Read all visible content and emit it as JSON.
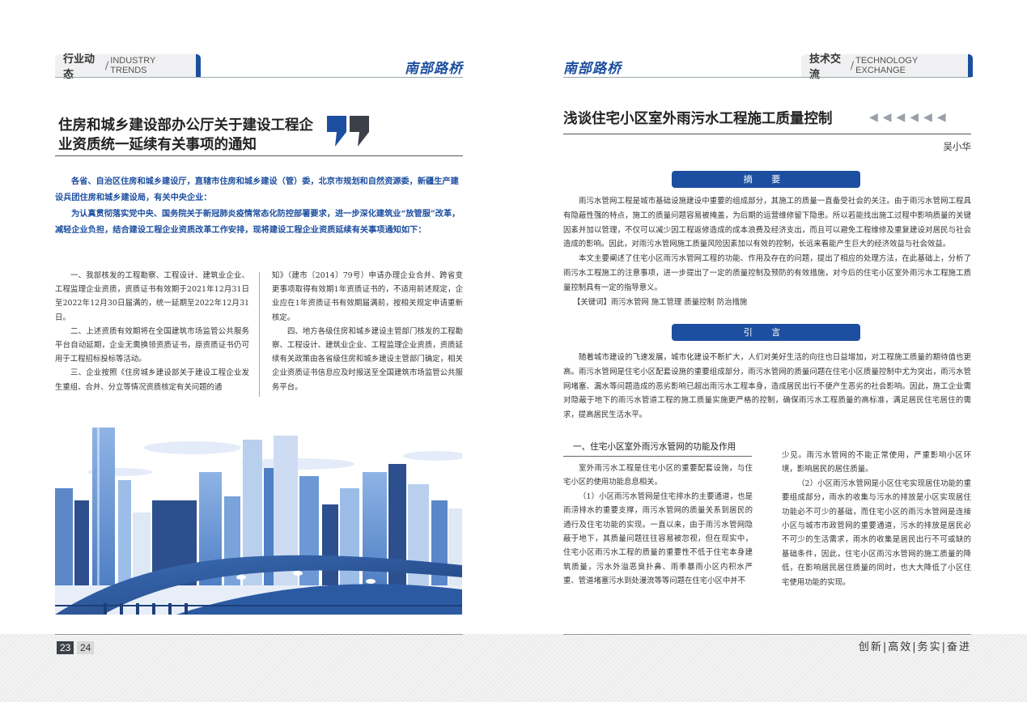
{
  "left": {
    "section_tab": {
      "zh": "行业动态",
      "sep": "/",
      "en": "INDUSTRY TRENDS"
    },
    "brand": "南部路桥",
    "title": "住房和城乡建设部办公厅关于建设工程企业资质统一延续有关事项的通知",
    "intro": [
      "各省、自治区住房和城乡建设厅，直辖市住房和城乡建设（管）委，北京市规划和自然资源委，新疆生产建设兵团住房和城乡建设局，有关中央企业：",
      "为认真贯彻落实党中央、国务院关于新冠肺炎疫情常态化防控部署要求，进一步深化建筑业“放管服”改革，减轻企业负担，结合建设工程企业资质改革工作安排，现将建设工程企业资质延续有关事项通知如下："
    ],
    "col1": [
      "一、我部核发的工程勘察、工程设计、建筑业企业、工程监理企业资质，资质证书有效期于2021年12月31日至2022年12月30日届满的，统一延期至2022年12月31日。",
      "二、上述资质有效期将在全国建筑市场监管公共服务平台自动延期，企业无需换领资质证书，原资质证书仍可用于工程招标投标等活动。",
      "三、企业按照《住房城乡建设部关于建设工程企业发生重组、合并、分立等情况资质核定有关问题的通"
    ],
    "col2": [
      "知》（建市〔2014〕79号）申请办理企业合并、跨省变更事项取得有效期1年资质证书的，不适用前述规定，企业应在1年资质证书有效期届满前，按相关规定申请重新核定。",
      "四、地方各级住房和城乡建设主管部门核发的工程勘察、工程设计、建筑业企业、工程监理企业资质，资质延续有关政策由各省级住房和城乡建设主管部门确定，相关企业资质证书信息应及时报送至全国建筑市场监管公共服务平台。"
    ],
    "page_numbers": [
      "23",
      "24"
    ]
  },
  "right": {
    "brand": "南部路桥",
    "section_tab": {
      "zh": "技术交流",
      "sep": "/",
      "en": "TECHNOLOGY EXCHANGE"
    },
    "title": "浅谈住宅小区室外雨污水工程施工质量控制",
    "arrows": "◀◀◀◀◀◀",
    "author": "吴小华",
    "abstract_label": "摘  要",
    "abstract": [
      "雨污水管网工程是城市基础设施建设中重要的组成部分，其施工的质量一直备受社会的关注。由于雨污水管网工程具有隐蔽性强的特点，施工的质量问题容易被掩盖，为后期的运营维修留下隐患。所以若能找出施工过程中影响质量的关键因素并加以管理，不仅可以减少因工程返修造成的成本浪费及经济支出，而且可以避免工程维修及重复建设对居民与社会造成的影响。因此，对雨污水管网施工质量风险因素加以有效的控制，长远来看能产生巨大的经济效益与社会效益。",
      "本文主要阐述了住宅小区雨污水管网工程的功能、作用及存在的问题，提出了相应的处理方法，在此基础上，分析了雨污水工程施工的注意事项，进一步提出了一定的质量控制及预防的有效措施，对今后的住宅小区室外雨污水工程施工质量控制具有一定的指导意义。"
    ],
    "keywords": "【关键词】雨污水管网  施工管理  质量控制  防治措施",
    "intro_label": "引  言",
    "intro": "随着城市建设的飞速发展，城市化建设不断扩大，人们对美好生活的向往也日益增加，对工程施工质量的期待值也更高。雨污水管网是住宅小区配套设施的重要组成部分，雨污水管网的质量问题在住宅小区质量控制中尤为突出，雨污水管网堵塞、漏水等问题造成的恶劣影响已超出雨污水工程本身，造成居民出行不便产生恶劣的社会影响。因此，施工企业需对隐蔽于地下的雨污水管道工程的施工质量实施更严格的控制，确保雨污水工程质量的高标准，满足居民住宅居住的需求，提高居民生活水平。",
    "section1_title": "一、住宅小区室外雨污水管网的功能及作用",
    "col1": [
      "室外雨污水工程是住宅小区的重要配套设施，与住宅小区的使用功能息息相关。",
      "（1）小区雨污水管网是住宅排水的主要通道，也是雨涝排水的重要支撑，雨污水管网的质量关系到居民的通行及住宅功能的实现。一直以来，由于雨污水管网隐蔽于地下，其质量问题往往容易被忽视，但在现实中，住宅小区雨污水工程的质量的重要性不低于住宅本身建筑质量，污水外溢恶臭扑鼻、雨季暴雨小区内积水严重、管道堵塞污水到处漫流等等问题在住宅小区中并不"
    ],
    "col2": [
      "少见。雨污水管网的不能正常使用，严重影响小区环境，影响居民的居住质量。",
      "（2）小区雨污水管网是小区住宅实现居住功能的重要组成部分，雨水的收集与污水的排放是小区实现居住功能必不可少的基础，而住宅小区的雨污水管网是连接小区与城市市政管网的重要通道，污水的排放是居民必不可少的生活需求，雨水的收集是居民出行不可或缺的基础条件，因此，住宅小区雨污水管网的施工质量的降低，在影响居民居住质量的同时，也大大降低了小区住宅使用功能的实现。"
    ],
    "motto": "创新|高效|务实|奋进"
  },
  "colors": {
    "accent_blue": "#1d4fa0",
    "quote_dark": "#3c4048"
  }
}
